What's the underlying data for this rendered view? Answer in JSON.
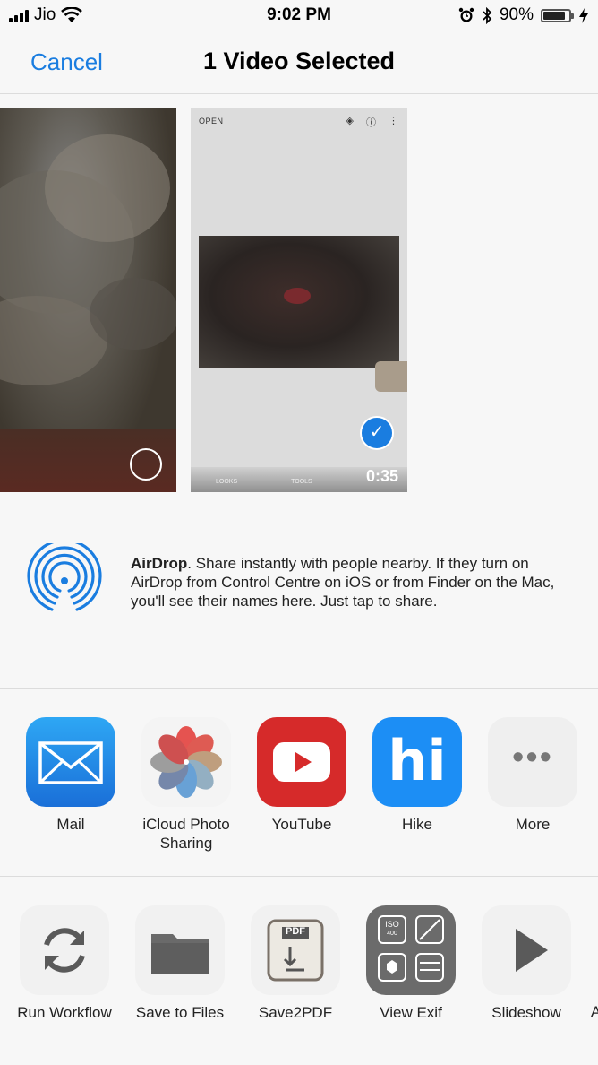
{
  "status_bar": {
    "carrier": "Jio",
    "time": "9:02 PM",
    "battery": "90%",
    "battery_level": 0.9
  },
  "nav": {
    "cancel_label": "Cancel",
    "title": "1 Video Selected"
  },
  "media": {
    "thumb2_open_label": "OPEN",
    "thumb2_tab_looks": "LOOKS",
    "thumb2_tab_tools": "TOOLS",
    "duration": "0:35"
  },
  "airdrop": {
    "title": "AirDrop",
    "description": ". Share instantly with people nearby. If they turn on AirDrop from Control Centre on iOS or from Finder on the Mac, you'll see their names here. Just tap to share."
  },
  "apps": [
    {
      "label": "Mail",
      "icon": "mail-icon"
    },
    {
      "label": "iCloud Photo Sharing",
      "icon": "photos-icon"
    },
    {
      "label": "YouTube",
      "icon": "youtube-icon"
    },
    {
      "label": "Hike",
      "icon": "hike-icon",
      "glyph": "hi"
    },
    {
      "label": "More",
      "icon": "more-icon",
      "glyph": "•••"
    }
  ],
  "actions": [
    {
      "label": "Run Workflow",
      "icon": "refresh-icon"
    },
    {
      "label": "Save to Files",
      "icon": "folder-icon"
    },
    {
      "label": "Save2PDF",
      "icon": "pdf-icon",
      "badge": "PDF"
    },
    {
      "label": "View Exif",
      "icon": "exif-icon",
      "badge": "ISO",
      "badge_value": "400"
    },
    {
      "label": "Slideshow",
      "icon": "play-icon"
    },
    {
      "label": "A",
      "icon": "partial-action"
    }
  ],
  "colors": {
    "accent": "#1a7de0",
    "background": "#f7f7f7",
    "divider": "#dcdcdc"
  }
}
